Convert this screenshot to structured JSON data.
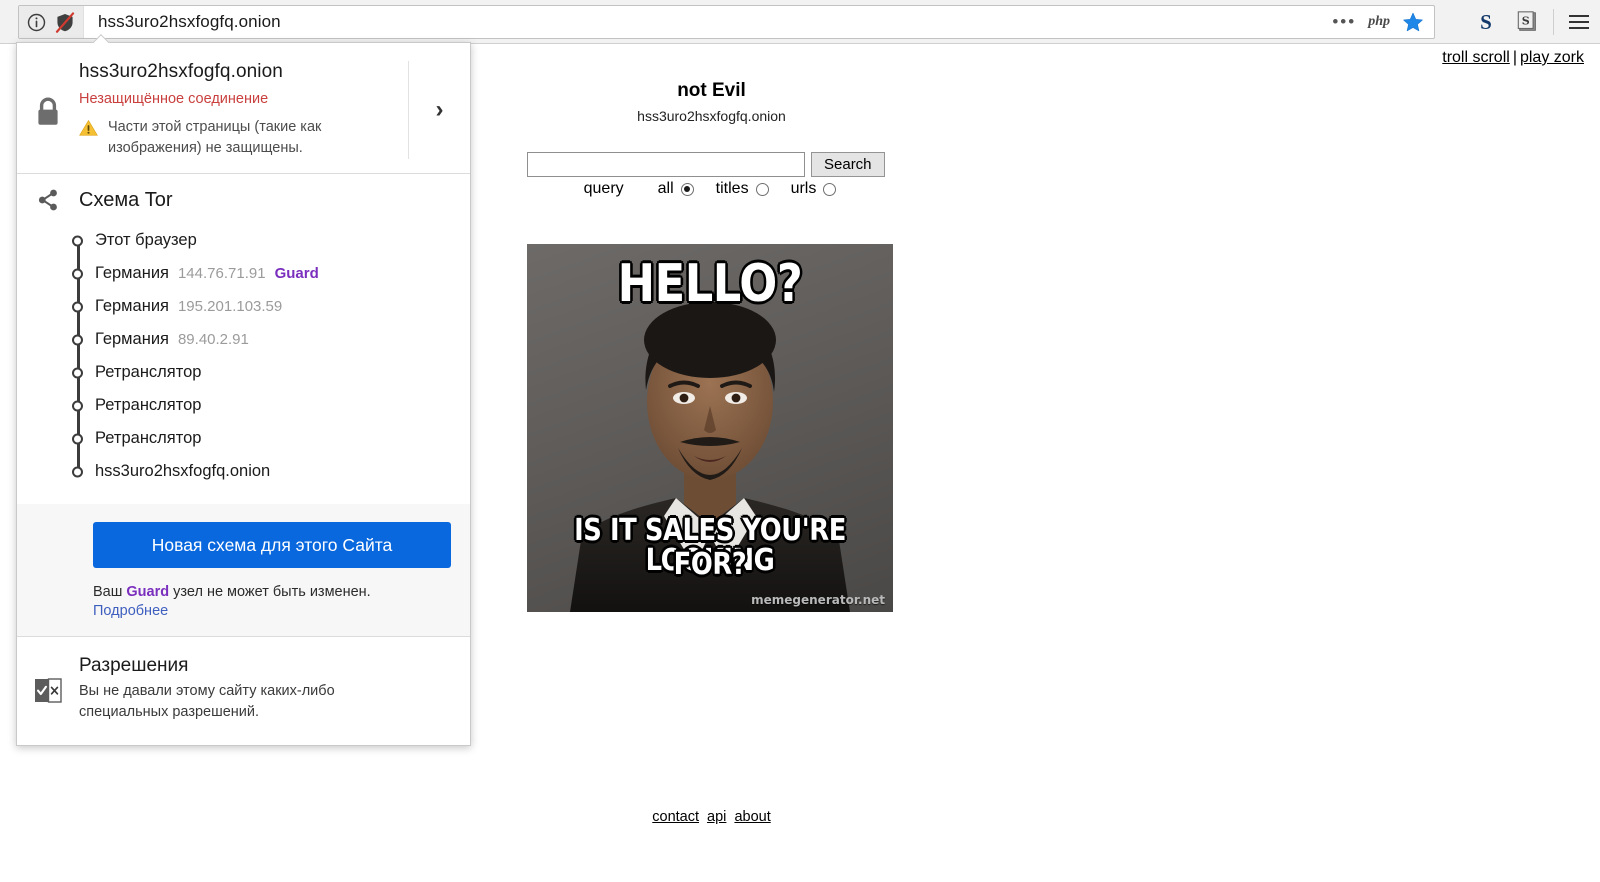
{
  "browser": {
    "url": "hss3uro2hsxfogfq.onion",
    "identity_icon": "info-circle-icon",
    "shield_icon": "shield-crossed-icon",
    "dots": "•••",
    "php_badge": "php",
    "bookmark_icon": "star-icon",
    "ext_s_icon": "S",
    "ext_badge_icon": "S",
    "menu_icon": "hamburger-icon"
  },
  "identity_popup": {
    "host": "hss3uro2hsxfogfq.onion",
    "connection_status": "Незащищённое соединение",
    "mixed_content_warning": "Части этой страницы (такие как изображения) не защищены.",
    "expand_chevron": "›",
    "tor": {
      "title": "Схема Tor",
      "nodes": [
        {
          "label": "Этот браузер",
          "ip": "",
          "tag": ""
        },
        {
          "label": "Германия",
          "ip": "144.76.71.91",
          "tag": "Guard"
        },
        {
          "label": "Германия",
          "ip": "195.201.103.59",
          "tag": ""
        },
        {
          "label": "Германия",
          "ip": "89.40.2.91",
          "tag": ""
        },
        {
          "label": "Ретранслятор",
          "ip": "",
          "tag": ""
        },
        {
          "label": "Ретранслятор",
          "ip": "",
          "tag": ""
        },
        {
          "label": "Ретранслятор",
          "ip": "",
          "tag": ""
        },
        {
          "label": "hss3uro2hsxfogfq.onion",
          "ip": "",
          "tag": ""
        }
      ]
    },
    "new_circuit_button": "Новая схема для этого Сайта",
    "guard_note_prefix": "Ваш ",
    "guard_note_bold": "Guard",
    "guard_note_suffix": " узел не может быть изменен.",
    "learn_more": "Подробнее",
    "permissions_title": "Разрешения",
    "permissions_text": "Вы не давали этому сайту каких-либо специальных разрешений."
  },
  "page": {
    "top_links": {
      "troll": "troll scroll",
      "separator": "|",
      "zork": "play zork"
    },
    "site_title": "not Evil",
    "site_subtitle": "hss3uro2hsxfogfq.onion",
    "search": {
      "value": "",
      "placeholder": "",
      "button": "Search"
    },
    "query_label": "query",
    "scopes": [
      {
        "label": "all",
        "selected": true
      },
      {
        "label": "titles",
        "selected": false
      },
      {
        "label": "urls",
        "selected": false
      }
    ],
    "meme": {
      "top_text": "HELLO?",
      "bottom_line1": "IS IT SALES YOU'RE LOOKING",
      "bottom_line2": "FOR?",
      "watermark": "memegenerator.net"
    },
    "footer": {
      "contact": "contact",
      "api": "api",
      "about": "about"
    }
  },
  "colors": {
    "accent_blue": "#0a68df",
    "insecure_red": "#c9403f",
    "guard_purple": "#7b2fbe",
    "link_blue": "#3f5fbf",
    "warn_yellow": "#f5c033"
  }
}
